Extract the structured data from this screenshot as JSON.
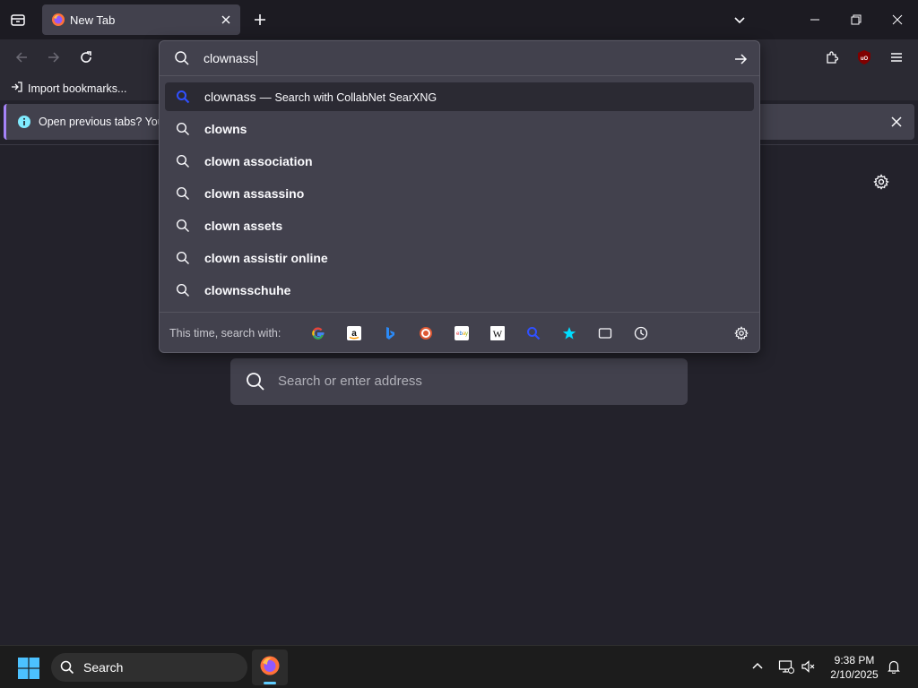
{
  "window": {
    "tab_title": "New Tab",
    "icons": {
      "tab_overview": "tab-overview-icon",
      "favicon": "firefox-icon",
      "close": "close-icon",
      "new_tab": "plus-icon",
      "list_tabs": "chevron-down-icon",
      "minimize": "minimize-icon",
      "restore": "restore-icon",
      "window_close": "close-icon"
    }
  },
  "toolbar": {
    "icons": {
      "back": "arrow-left-icon",
      "forward": "arrow-right-icon",
      "reload": "reload-icon",
      "extensions": "puzzle-icon",
      "ublock": "ublock-origin-icon",
      "menu": "hamburger-menu-icon"
    },
    "ublock_badge": "uO"
  },
  "bookmarks": {
    "import_label": "Import bookmarks..."
  },
  "notification": {
    "text": "Open previous tabs? You c"
  },
  "urlbar": {
    "value": "clownass",
    "selected_result": {
      "query": "clownass",
      "separator": "—",
      "engine_text": "Search with CollabNet SearXNG"
    },
    "suggestions": [
      "clowns",
      "clown association",
      "clown assassino",
      "clown assets",
      "clown assistir online",
      "clownsschuhe"
    ],
    "oneoff_label": "This time, search with:",
    "oneoff_engines": [
      "google-icon",
      "amazon-icon",
      "bing-icon",
      "duckduckgo-icon",
      "ebay-icon",
      "wikipedia-icon",
      "searxng-icon",
      "bookmarks-star-icon",
      "tabs-icon",
      "history-icon"
    ],
    "settings_icon": "gear-icon"
  },
  "newtab": {
    "search_placeholder": "Search or enter address"
  },
  "taskbar": {
    "search_label": "Search",
    "time": "9:38 PM",
    "date": "2/10/2025"
  },
  "colors": {
    "accent_purple": "#a583f8",
    "searxng_blue": "#3050ff",
    "info_blue": "#80ebff"
  }
}
